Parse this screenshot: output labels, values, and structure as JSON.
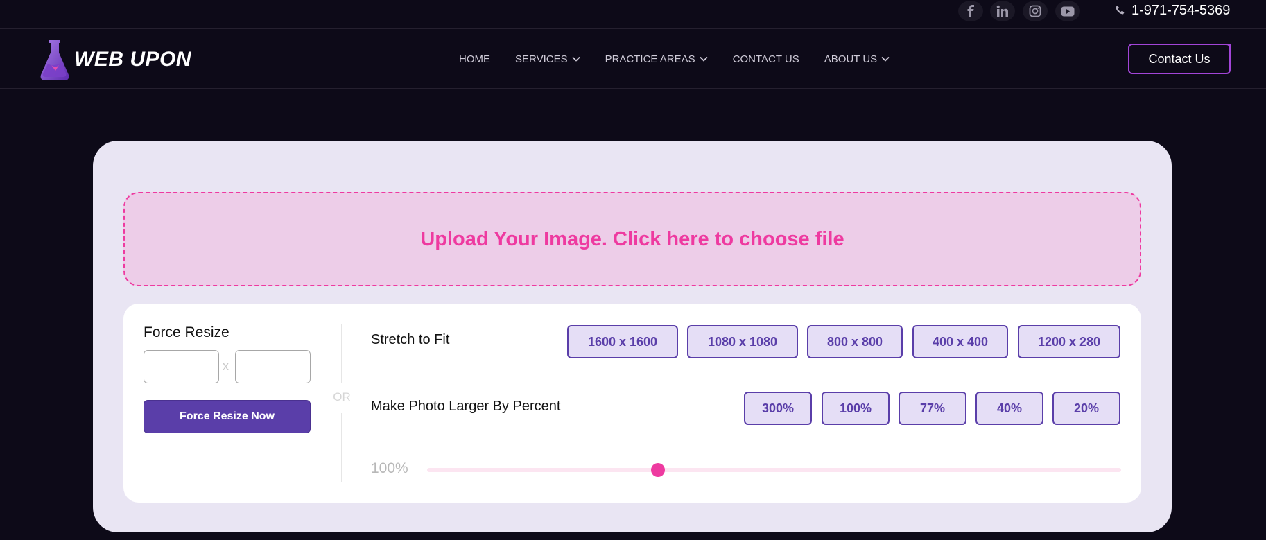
{
  "topbar": {
    "social": [
      {
        "name": "facebook-icon"
      },
      {
        "name": "linkedin-icon"
      },
      {
        "name": "instagram-icon"
      },
      {
        "name": "youtube-icon"
      }
    ],
    "phone": "1-971-754-5369"
  },
  "nav": {
    "logo_text": "WEB UPON",
    "menu": [
      {
        "label": "HOME",
        "dropdown": false
      },
      {
        "label": "SERVICES",
        "dropdown": true
      },
      {
        "label": "PRACTICE AREAS",
        "dropdown": true
      },
      {
        "label": "CONTACT US",
        "dropdown": false
      },
      {
        "label": "ABOUT US",
        "dropdown": true
      }
    ],
    "contact_button": "Contact Us"
  },
  "upload": {
    "label": "Upload Your Image. Click here to choose file"
  },
  "force_resize": {
    "title": "Force Resize",
    "width_value": "",
    "height_value": "",
    "separator": "x",
    "button": "Force Resize Now"
  },
  "or_label": "OR",
  "stretch": {
    "label": "Stretch to Fit",
    "presets": [
      "1600 x 1600",
      "1080 x 1080",
      "800 x 800",
      "400 x 400",
      "1200 x 280"
    ]
  },
  "larger": {
    "label": "Make Photo Larger By Percent",
    "presets": [
      "300%",
      "100%",
      "77%",
      "40%",
      "20%"
    ]
  },
  "slider": {
    "readout": "100%",
    "position_fraction": 0.333
  },
  "colors": {
    "accent_pink": "#ee3aa0",
    "accent_purple": "#5a3ea9",
    "page_bg": "#0d0a18",
    "card_bg": "#e9e5f3"
  }
}
